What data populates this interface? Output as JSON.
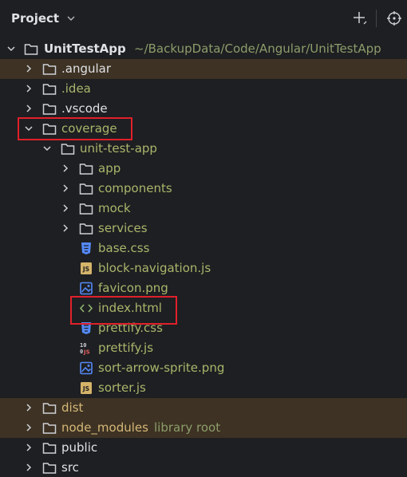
{
  "header": {
    "title": "Project"
  },
  "tree": [
    {
      "label": "UnitTestApp",
      "path": "~/BackupData/Code/Angular/UnitTestApp",
      "type": "folder",
      "expanded": true
    },
    {
      "label": ".angular",
      "type": "folder",
      "expanded": false,
      "excluded": true
    },
    {
      "label": ".idea",
      "type": "folder",
      "expanded": false
    },
    {
      "label": ".vscode",
      "type": "folder",
      "expanded": false
    },
    {
      "label": "coverage",
      "type": "folder",
      "expanded": true
    },
    {
      "label": "unit-test-app",
      "type": "folder",
      "expanded": true
    },
    {
      "label": "app",
      "type": "folder",
      "expanded": false
    },
    {
      "label": "components",
      "type": "folder",
      "expanded": false
    },
    {
      "label": "mock",
      "type": "folder",
      "expanded": false
    },
    {
      "label": "services",
      "type": "folder",
      "expanded": false
    },
    {
      "label": "base.css",
      "type": "css-file"
    },
    {
      "label": "block-navigation.js",
      "type": "js-file"
    },
    {
      "label": "favicon.png",
      "type": "image-file"
    },
    {
      "label": "index.html",
      "type": "html-file"
    },
    {
      "label": "prettify.css",
      "type": "css-file"
    },
    {
      "label": "prettify.js",
      "type": "js-file-binary"
    },
    {
      "label": "sort-arrow-sprite.png",
      "type": "image-file"
    },
    {
      "label": "sorter.js",
      "type": "js-file"
    },
    {
      "label": "dist",
      "type": "folder",
      "expanded": false,
      "excluded": true
    },
    {
      "label": "node_modules",
      "extra": "library root",
      "type": "folder",
      "expanded": false,
      "excluded": true
    },
    {
      "label": "public",
      "type": "folder",
      "expanded": false
    },
    {
      "label": "src",
      "type": "folder",
      "expanded": false
    }
  ],
  "colors": {
    "background": "#1e1f22",
    "excluded_row": "#3d3223",
    "text_default": "#dfe1e5",
    "text_green": "#a9b66b",
    "text_excluded": "#d5b778",
    "highlight_box": "#e0202a",
    "css_icon": "#548af7",
    "js_icon": "#d5b46a"
  },
  "icons": {
    "add": "plus-icon",
    "locate": "crosshair-icon",
    "collapse": "chevron-down-icon",
    "expand": "chevron-right-icon"
  }
}
